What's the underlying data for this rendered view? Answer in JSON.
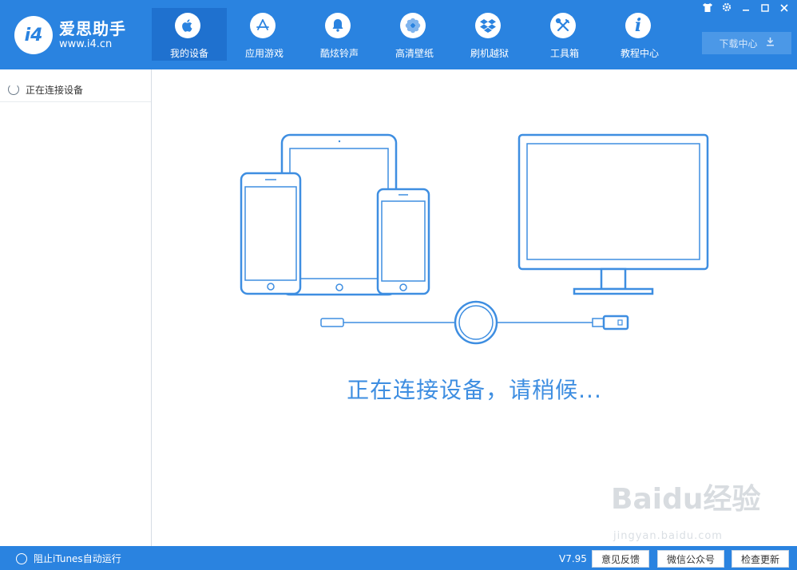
{
  "app": {
    "logo_letter": "i4",
    "name": "爱思助手",
    "url": "www.i4.cn"
  },
  "nav": {
    "items": [
      {
        "label": "我的设备",
        "icon": "apple-icon",
        "active": true
      },
      {
        "label": "应用游戏",
        "icon": "app-store-icon"
      },
      {
        "label": "酷炫铃声",
        "icon": "bell-icon"
      },
      {
        "label": "高清壁纸",
        "icon": "flower-icon"
      },
      {
        "label": "刷机越狱",
        "icon": "dropbox-icon"
      },
      {
        "label": "工具箱",
        "icon": "tools-icon"
      },
      {
        "label": "教程中心",
        "icon": "info-icon"
      }
    ]
  },
  "window_controls": [
    "shirt-icon",
    "settings-icon",
    "minimize-icon",
    "maximize-icon",
    "close-icon"
  ],
  "download": {
    "label": "下载中心",
    "icon": "download-icon"
  },
  "sidebar": {
    "items": [
      {
        "label": "正在连接设备",
        "icon": "spinner-icon"
      }
    ]
  },
  "main": {
    "status": "正在连接设备，请稍候..."
  },
  "footer": {
    "itunes_label": "阻止iTunes自动运行",
    "version": "V7.95",
    "buttons": [
      "意见反馈",
      "微信公众号",
      "检查更新"
    ]
  },
  "watermark": {
    "text": "Baidu经验",
    "sub": "jingyan.baidu.com"
  },
  "colors": {
    "accent": "#2a83e0",
    "nav_active": "#1f71cf",
    "device_stroke": "#3e8ee1"
  }
}
